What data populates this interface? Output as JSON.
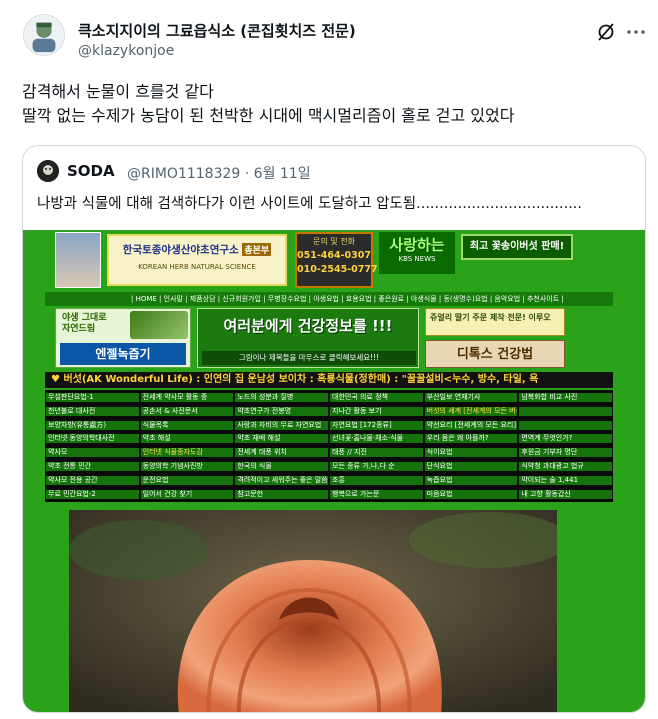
{
  "post": {
    "display_name": "큭소지지이의 그료읍식소 (콘집횟치즈 전문)",
    "handle": "@klazykonjoe",
    "body_lines": [
      "감격해서 눈물이 흐를것 같다",
      "딸깍 없는 수제가 농담이 된 천박한 시대에 맥시멀리즘이 홀로 걷고 있었다"
    ],
    "icons": [
      "grok-icon",
      "more-icon"
    ]
  },
  "quote": {
    "name": "SODA",
    "handle_date": "@RIMO1118329 · 6월 11일",
    "text": "나방과 식물에 대해 검색하다가 이런 사이트에 도달하고 압도됨...................................."
  },
  "site": {
    "lab_title": "한국토종야생산야초연구소",
    "lab_badge": "총본부",
    "lab_sub": "KOREAN HERB NATURAL SCIENCE",
    "phone_head": "문의 및 전화",
    "phone_1": "051-464-0307",
    "phone_2": "010-2545-0777",
    "love_title": "사랑하는",
    "love_sub": "KBS NEWS",
    "best_banner": "최고 꽃송이버섯 판매!",
    "nav": "| HOME | 인사말 | 제품상담 | 신규회원가입 | 무병장수요법 | 야생요법 | 효용요법 | 좋은원료 | 야생식물 | 동(생명수)요법 | 음악요법 | 추천사이트 |",
    "left_banner_top": "야생 그대로\n자연드림",
    "left_banner_bottom": "엔젤녹즙기",
    "mid_title": "여러분에게 건강정보를 !!!",
    "mid_sub": "그림이나 제목들을 마우스로 클릭해보세요!!!",
    "right_banner": "쥬얼리 딸기 주문 제작 전문! 이루오",
    "dtox_banner": "디톡스 건강법",
    "marquee": "♥ 버섯(AK Wonderful Life) : 인연의 집 운남성 보이차 : 흑룡식물(정한매) : \"꿀꿀설비<누수, 방수, 타일, 욕",
    "grid_rows": [
      [
        "무설판단요법-1",
        "천년불로 대사전",
        "보양차방(유통處方)",
        "인터넷 동양의학대사전",
        "약사모",
        "약초 전통 민간",
        "약사모 전용 공간",
        "무료 민간요법-2"
      ],
      [
        "전세계 약사모 활동 중",
        "공손서 & 사진문서",
        "식물목록",
        "약초 해설",
        "인터넷 식물종자도감",
        "동양의학 기념사진방",
        "운전요법",
        "일어서 건강 찾기"
      ],
      [
        "노드의 성분과 질병",
        "약초연구가 전봉명",
        "사랑과 자비의 무료 자연요법",
        "약초 재배 해설",
        "전세계 태풍 위치",
        "한국의 식물",
        "격려적이고 세워주는 좋은 말씀",
        "참고문헌"
      ],
      [
        "대한민국 의료 정책",
        "지나간 활동 보기",
        "자연요법 [172종류]",
        "선녀꽃·홈나물·채소·식물",
        "태풍 // 지진",
        "모든 종류 가,나,다 순",
        "조흥",
        "행복으로 가는문"
      ],
      [
        "부산일보 연재기사",
        "버섯의 세계 [전세계의 모든 버섯] 0681종",
        "약선요리 [전세계의 모든 요리] 1,173",
        "우리 몸은 왜 아플까?",
        "식이요법",
        "단식요법",
        "녹즙요법",
        "미음요법"
      ],
      [
        "남북화합 비교 사진",
        "",
        "",
        "면역계 무엇인가?",
        "후원금 기부자 명단",
        "식약청 과대광고 법규",
        "약이되는 술 1,441",
        "내 고향 활동갑신"
      ]
    ]
  }
}
